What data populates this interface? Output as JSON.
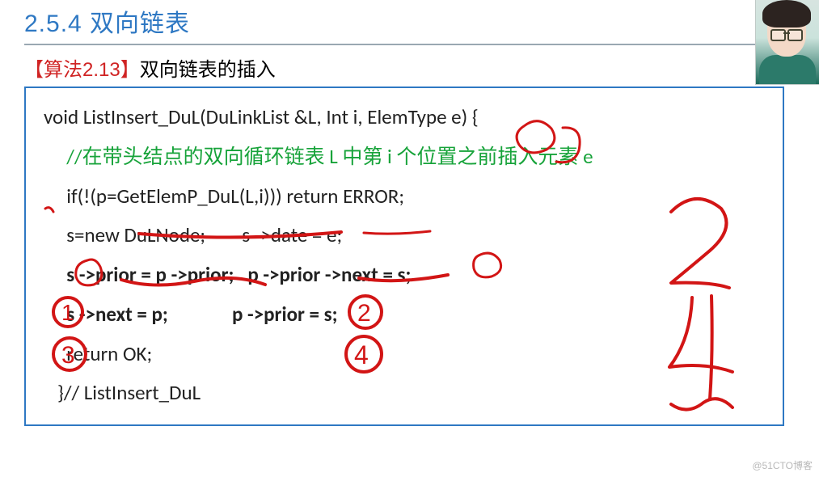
{
  "section_title": "2.5.4 双向链表",
  "algorithm": {
    "tag": "【算法2.13】",
    "desc": "双向链表的插入"
  },
  "code": {
    "line1": "void ListInsert_DuL(DuLinkList &L, Int i, ElemType e) {",
    "comment": "//在带头结点的双向循环链表 L 中第 i 个位置之前插入元素 e",
    "line3": "if(!(p=GetElemP_DuL(L,i))) return ERROR;",
    "line4a": "s=new DuLNode;",
    "line4b": "s ->date = e;",
    "line5a": "s ->prior = p ->prior;",
    "line5b": "p ->prior ->next = s;",
    "line6a": "s ->next = p;",
    "line6b": "p ->prior = s;",
    "line7": "return OK;",
    "line8": "}// ListInsert_DuL"
  },
  "annotations": {
    "steps": [
      "1",
      "2",
      "3",
      "4"
    ],
    "big_numbers": [
      "2",
      "4"
    ]
  },
  "watermark": "@51CTO博客"
}
